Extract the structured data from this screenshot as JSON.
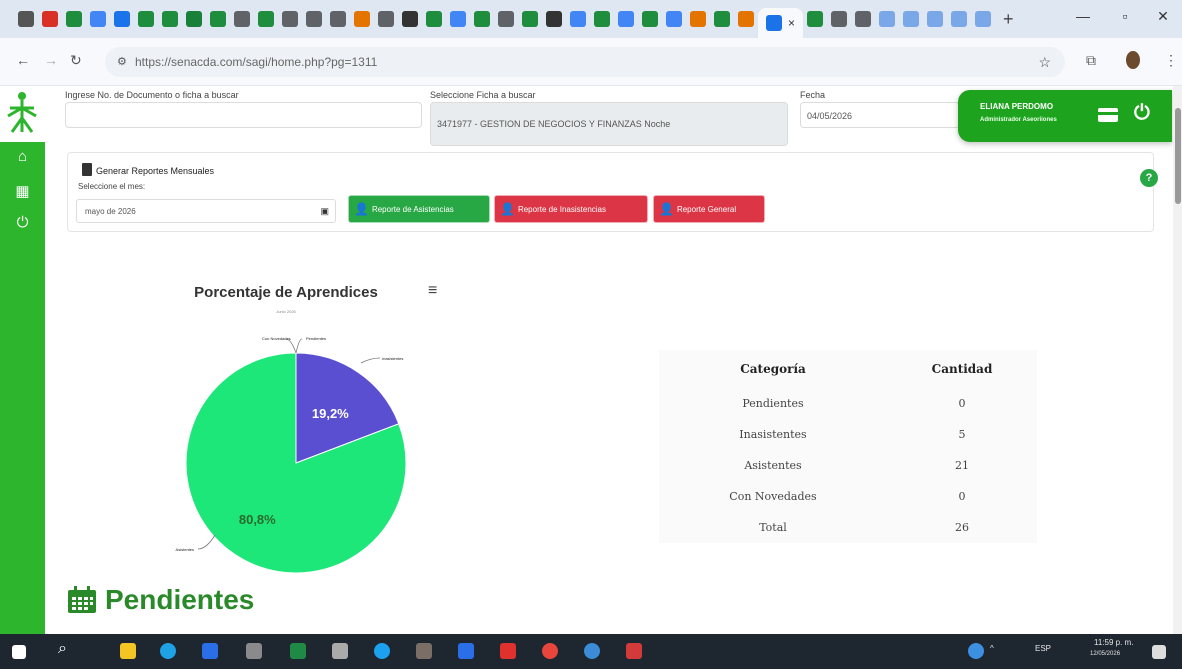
{
  "browser": {
    "url": "https://senacda.com/sagi/home.php?pg=1311",
    "tab_close": "×",
    "new_tab": "+"
  },
  "form": {
    "doc_label": "Ingrese No. de Documento o ficha a buscar",
    "doc_value": "",
    "ficha_label": "Seleccione Ficha a buscar",
    "ficha_value": "3471977 - GESTION DE NEGOCIOS Y FINANZAS Noche",
    "fecha_label": "Fecha",
    "fecha_value": "04/05/2026"
  },
  "user": {
    "name": "ELIANA PERDOMO",
    "role": "Administrador Aseoriiones"
  },
  "reports": {
    "title": "Generar Reportes Mensuales",
    "month_label": "Seleccione el mes:",
    "month_value": "mayo de 2026",
    "btn_asistencias": "Reporte de Asistencias",
    "btn_inasistencias": "Reporte de Inasistencias",
    "btn_general": "Reporte General"
  },
  "chart_data": {
    "type": "pie",
    "title": "Porcentaje de Aprendices",
    "subtitle": "Junio 2026",
    "slices": [
      {
        "label": "Asistentes",
        "value": 80.8,
        "display": "80,8%",
        "color": "#1ee77a"
      },
      {
        "label": "Inasistentes",
        "value": 19.2,
        "display": "19,2%",
        "color": "#5b4fd1"
      },
      {
        "label": "Pendientes",
        "value": 0,
        "display": "",
        "color": "#333333"
      },
      {
        "label": "Con Novedades",
        "value": 0,
        "display": "",
        "color": "#333333"
      }
    ]
  },
  "table": {
    "headers": [
      "Categoría",
      "Cantidad"
    ],
    "rows": [
      [
        "Pendientes",
        "0"
      ],
      [
        "Inasistentes",
        "5"
      ],
      [
        "Asistentes",
        "21"
      ],
      [
        "Con Novedades",
        "0"
      ],
      [
        "Total",
        "26"
      ]
    ]
  },
  "section_title": "Pendientes",
  "tray": {
    "lang": "ESP",
    "time": "11:59 p. m.",
    "date": "12/05/2026"
  }
}
